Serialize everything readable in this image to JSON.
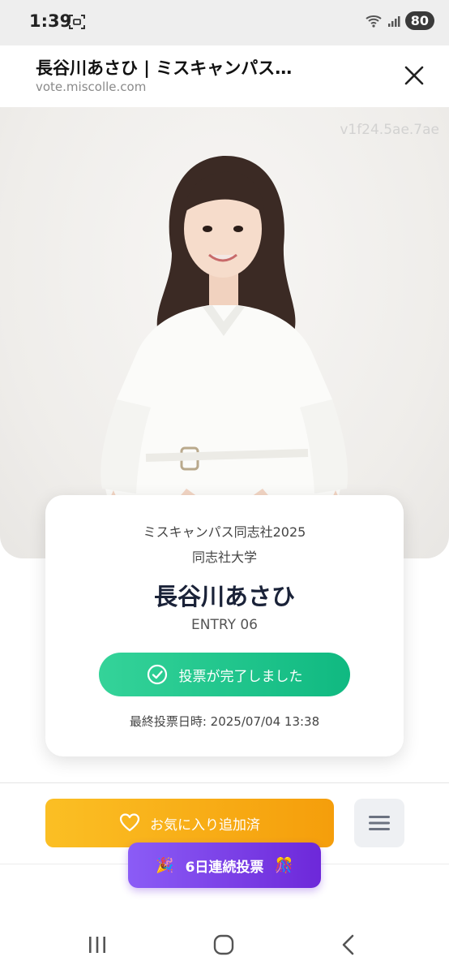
{
  "status": {
    "time": "1:39",
    "battery": "80"
  },
  "browser": {
    "title": "長谷川あさひ | ミスキャンパス…",
    "url": "vote.miscolle.com"
  },
  "photo": {
    "watermark": "v1f24.5ae.7ae"
  },
  "card": {
    "contest": "ミスキャンパス同志社2025",
    "university": "同志社大学",
    "name": "長谷川あさひ",
    "entry": "ENTRY 06",
    "vote_button_label": "投票が完了しました",
    "last_vote": "最終投票日時: 2025/07/04 13:38"
  },
  "actions": {
    "favorite_label": "お気に入り追加済",
    "streak_label": "6日連続投票",
    "streak_emoji_left": "🎉",
    "streak_emoji_right": "🎊"
  },
  "colors": {
    "vote_button": "#10b981",
    "favorite_button": "#f59e0b",
    "streak_badge": "#7c3aed"
  },
  "icons": {
    "close": "close-icon",
    "check": "check-circle-icon",
    "heart": "heart-icon",
    "menu": "hamburger-menu-icon"
  }
}
